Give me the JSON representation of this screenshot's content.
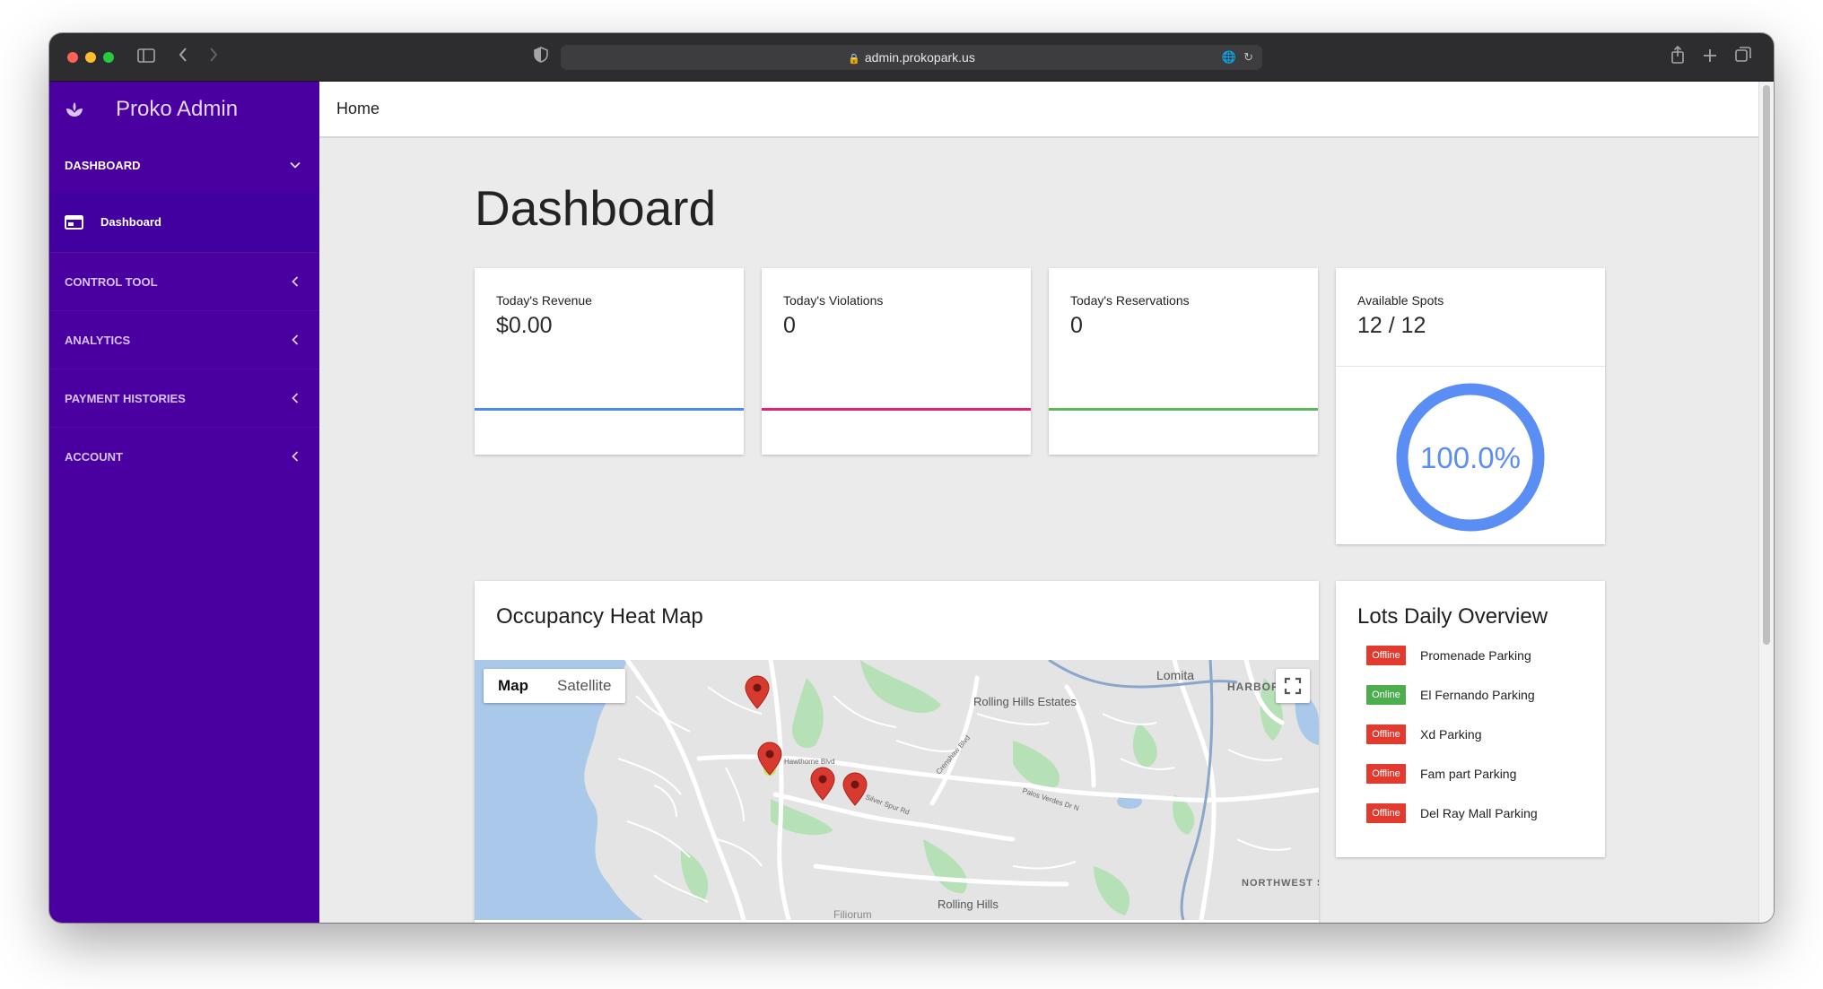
{
  "browser": {
    "url": "admin.prokopark.us"
  },
  "sidebar": {
    "brand": "Proko Admin",
    "sections": [
      {
        "label": "DASHBOARD",
        "expanded": true,
        "items": [
          {
            "label": "Dashboard"
          }
        ]
      },
      {
        "label": "CONTROL TOOL",
        "expanded": false
      },
      {
        "label": "ANALYTICS",
        "expanded": false
      },
      {
        "label": "PAYMENT HISTORIES",
        "expanded": false
      },
      {
        "label": "ACCOUNT",
        "expanded": false
      }
    ]
  },
  "topbar": {
    "breadcrumb": "Home"
  },
  "page": {
    "title": "Dashboard"
  },
  "stats": [
    {
      "label": "Today's Revenue",
      "value": "$0.00",
      "color": "#4b8af0"
    },
    {
      "label": "Today's Violations",
      "value": "0",
      "color": "#e4226e"
    },
    {
      "label": "Today's Reservations",
      "value": "0",
      "color": "#5cb85c"
    }
  ],
  "spots": {
    "label": "Available Spots",
    "value": "12 / 12",
    "percent_text": "100.0%",
    "fraction": 1.0,
    "color": "#5b8ef4"
  },
  "map_card": {
    "title": "Occupancy Heat Map",
    "map_btn": "Map",
    "satellite_btn": "Satellite",
    "labels": {
      "lomita": "Lomita",
      "rolling_hills_estates": "Rolling Hills Estates",
      "rolling_hills": "Rolling Hills",
      "harbor": "HARBOR",
      "northwest": "NORTHWEST SAN PEDRO",
      "hawthorne": "Hawthorne Blvd",
      "palos_verdes": "Palos Verdes Dr N",
      "silver_spur": "Silver Spur Rd",
      "crenshaw": "Crenshaw Blvd",
      "filiorum": "Filiorum"
    }
  },
  "lots": {
    "title": "Lots Daily Overview",
    "items": [
      {
        "status": "Offline",
        "name": "Promenade Parking"
      },
      {
        "status": "Online",
        "name": "El Fernando Parking"
      },
      {
        "status": "Offline",
        "name": "Xd Parking"
      },
      {
        "status": "Offline",
        "name": "Fam part Parking"
      },
      {
        "status": "Offline",
        "name": "Del Ray Mall Parking"
      }
    ],
    "colors": {
      "Offline": "#e23a2e",
      "Online": "#4cae4c"
    }
  }
}
